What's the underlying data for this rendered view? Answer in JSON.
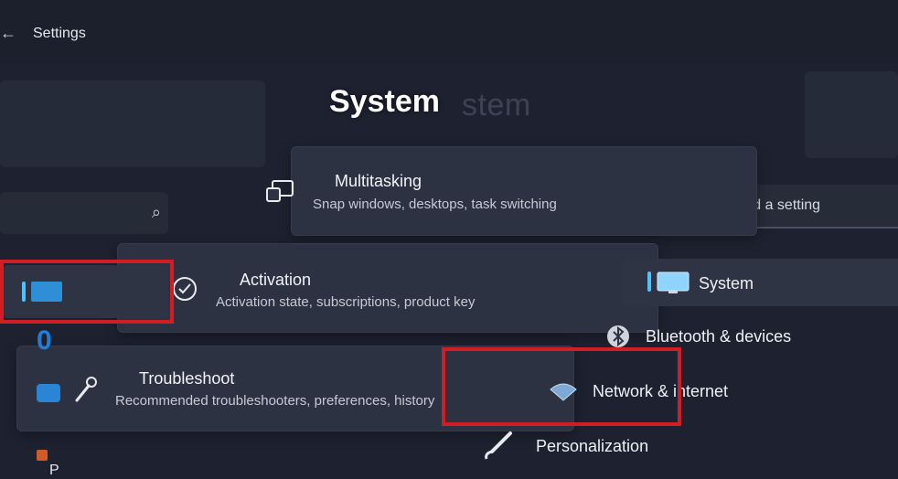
{
  "window": {
    "back_glyph": "←",
    "title": "Settings"
  },
  "page": {
    "title": "System",
    "ghost_title": "stem"
  },
  "search": {
    "left_icon": "search-icon",
    "find_placeholder": "Find a setting"
  },
  "cards": [
    {
      "title": "Multitasking",
      "desc": "Snap windows, desktops, task switching",
      "icon": "multitasking-icon"
    },
    {
      "title": "Activation",
      "desc": "Activation state, subscriptions, product key",
      "icon": "activation-icon"
    },
    {
      "title": "Troubleshoot",
      "desc": "Recommended troubleshooters, preferences, history",
      "icon": "troubleshoot-icon"
    }
  ],
  "nav": [
    {
      "label": "System",
      "icon": "monitor-icon",
      "selected": true
    },
    {
      "label": "Bluetooth & devices",
      "icon": "bluetooth-icon"
    },
    {
      "label": "Network & internet",
      "icon": "wifi-icon"
    },
    {
      "label": "Personalization",
      "icon": "brush-icon"
    }
  ],
  "partial": {
    "left_digit": "0",
    "bottom_left_text": "P"
  },
  "colors": {
    "accent": "#4cc2ff",
    "highlight": "#d11d24",
    "background": "#1e2230"
  }
}
